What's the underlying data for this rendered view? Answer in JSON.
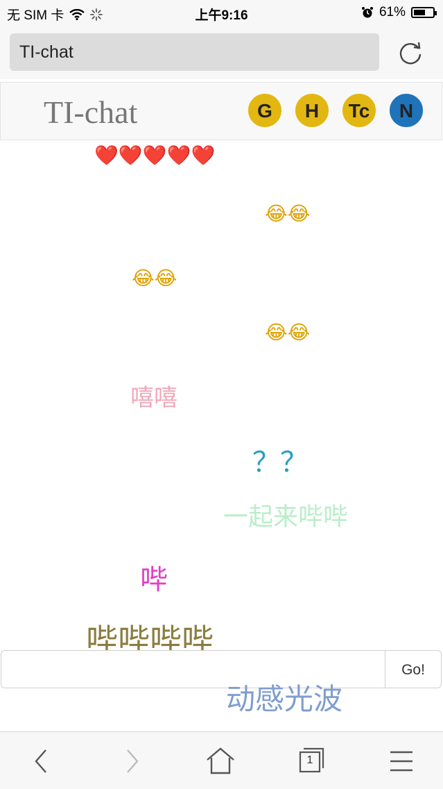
{
  "status_bar": {
    "carrier": "无 SIM 卡",
    "time": "上午9:16",
    "battery_text": "61%",
    "battery_level": 0.61
  },
  "browser": {
    "address": "TI-chat"
  },
  "header": {
    "brand": "TI-chat",
    "badges": [
      {
        "label": "G",
        "color": "#e3b712"
      },
      {
        "label": "H",
        "color": "#e3b712"
      },
      {
        "label": "Tc",
        "color": "#e3b712"
      },
      {
        "label": "N",
        "color": "#1f73b8"
      }
    ]
  },
  "messages": [
    {
      "text": "❤️❤️❤️❤️❤️",
      "color": "#d8202a"
    },
    {
      "text": "😂😂",
      "color": "#e0a100"
    },
    {
      "text": "😂😂",
      "color": "#e0a100"
    },
    {
      "text": "😂😂",
      "color": "#e0a100"
    },
    {
      "text": "嘻嘻",
      "color": "#f0a8b9"
    },
    {
      "text": "？？",
      "color": "#2a9fbd"
    },
    {
      "text": "一起来哔哔",
      "color": "#b9eec9"
    },
    {
      "text": "哔",
      "color": "#e23fc5"
    },
    {
      "text": "哔哔哔哔",
      "color": "#8a7d40"
    },
    {
      "text": "动感光波",
      "color": "#7f9ecf"
    }
  ],
  "input": {
    "value": "",
    "placeholder": "",
    "go_label": "Go!"
  },
  "toolbar": {
    "tab_count": "1"
  }
}
